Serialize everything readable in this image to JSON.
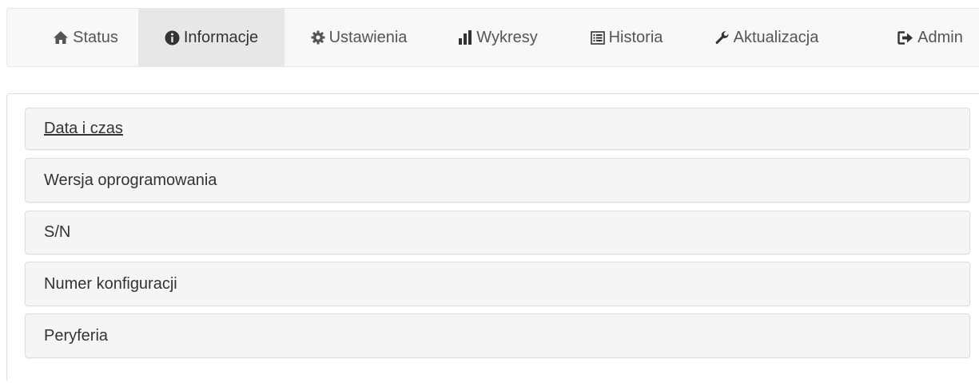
{
  "nav": {
    "items": [
      {
        "label": "Status",
        "icon": "home-icon"
      },
      {
        "label": "Informacje",
        "icon": "info-circle-icon"
      },
      {
        "label": "Ustawienia",
        "icon": "gear-icon"
      },
      {
        "label": "Wykresy",
        "icon": "bar-chart-icon"
      },
      {
        "label": "Historia",
        "icon": "list-alt-icon"
      },
      {
        "label": "Aktualizacja",
        "icon": "wrench-icon"
      },
      {
        "label": "Admin",
        "icon": "log-out-icon"
      }
    ],
    "active_label": "Informacje"
  },
  "panels": [
    {
      "title": "Data i czas"
    },
    {
      "title": "Wersja oprogramowania"
    },
    {
      "title": "S/N"
    },
    {
      "title": "Numer konfiguracji"
    },
    {
      "title": "Peryferia"
    }
  ],
  "colors": {
    "navbar_bg": "#f8f8f8",
    "active_tab_bg": "#e7e7e7",
    "nav_text": "#555555",
    "panel_heading_bg": "#f5f5f5",
    "border": "#dddddd"
  }
}
